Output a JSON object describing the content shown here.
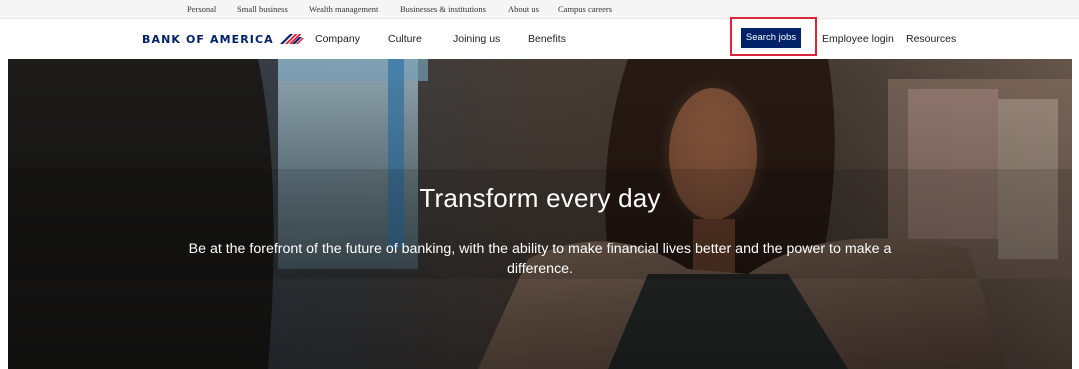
{
  "utility_nav": {
    "personal": "Personal",
    "small_business": "Small business",
    "wealth": "Wealth management",
    "businesses": "Businesses & institutions",
    "about": "About us",
    "campus": "Campus careers"
  },
  "header": {
    "logo_text": "BANK OF AMERICA",
    "nav": {
      "company": "Company",
      "culture": "Culture",
      "joining": "Joining us",
      "benefits": "Benefits"
    },
    "search_jobs": "Search jobs",
    "employee_login": "Employee login",
    "resources": "Resources"
  },
  "hero": {
    "title": "Transform every day",
    "subtitle": "Be at the forefront of the future of banking, with the ability to make financial lives better and the power to make a difference."
  },
  "colors": {
    "brand_navy": "#012169",
    "brand_red": "#e31837",
    "highlight_red": "#d9263a"
  }
}
